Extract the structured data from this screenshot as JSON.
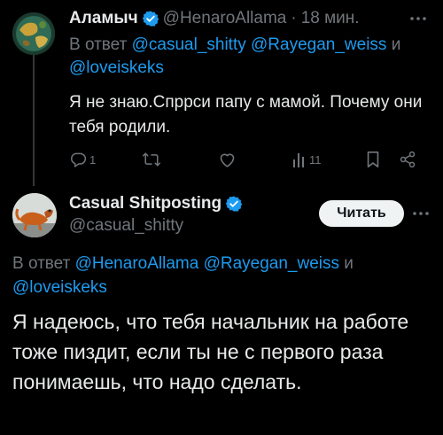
{
  "reply": {
    "author_name": "Аламыч",
    "author_handle": "@HenaroAllama",
    "separator": "·",
    "time": "18 мин.",
    "reply_prefix": "В ответ",
    "mentions": [
      "@casual_shitty",
      "@Rayegan_weiss"
    ],
    "reply_and": "и",
    "mention_last": "@loveiskeks",
    "text": "Я не знаю.Спррси папу с мамой. Почему они тебя родили.",
    "actions": {
      "replies_count": "1",
      "views_count": "11"
    }
  },
  "main": {
    "author_name": "Casual Shitposting",
    "author_handle": "@casual_shitty",
    "follow_label": "Читать",
    "reply_prefix": "В ответ",
    "mentions": [
      "@HenaroAllama",
      "@Rayegan_weiss"
    ],
    "reply_and": "и",
    "mention_last": "@loveiskeks",
    "text": "Я надеюсь, что тебя начальник на работе тоже пиздит, если ты не с первого раза понимаешь, что надо сделать."
  },
  "colors": {
    "background": "#000000",
    "text": "#e7e9ea",
    "muted": "#71767b",
    "link": "#1d9bf0",
    "verified": "#1d9bf0"
  },
  "icons": [
    "verified-badge-icon",
    "more-options-icon",
    "reply-icon",
    "retweet-icon",
    "like-icon",
    "views-icon",
    "bookmark-icon",
    "share-icon"
  ]
}
